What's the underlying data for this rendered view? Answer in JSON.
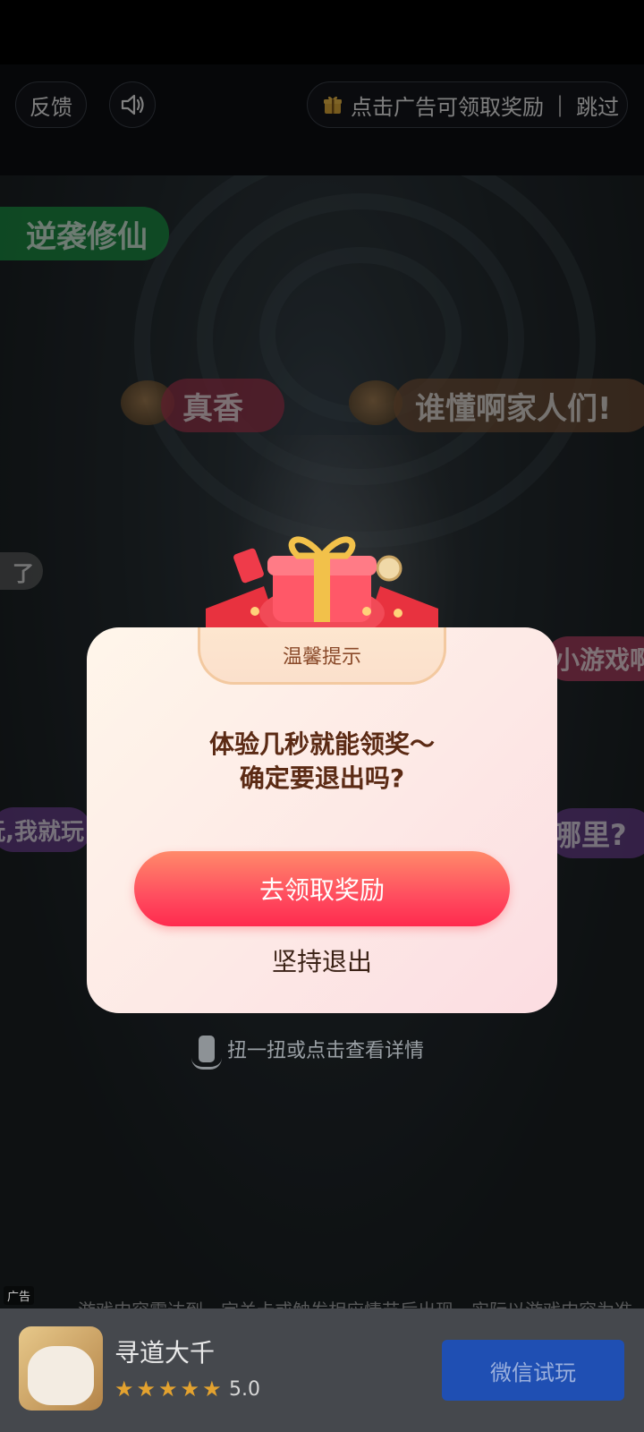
{
  "topbar": {
    "feedback_label": "反馈",
    "reward_label": "点击广告可领取奖励",
    "skip_label": "跳过"
  },
  "danmu": [
    "逆袭修仙",
    "真香",
    "谁懂啊家人们!",
    "了",
    "小游戏啊",
    "玩,我就玩",
    "哪里?"
  ],
  "dialog": {
    "title": "温馨提示",
    "message_line1": "体验几秒就能领奖～",
    "message_line2": "确定要退出吗?",
    "claim_button": "去领取奖励",
    "exit_button": "坚持退出"
  },
  "hint": "扭一扭或点击查看详情",
  "ad": {
    "tag": "广告",
    "disclaimer": "...游戏内容需达到一定关卡或触发相应情节后出现，实际以游戏内容为准",
    "app_name": "寻道大千",
    "rating": "5.0",
    "stars": 5,
    "cta": "微信试玩"
  },
  "colors": {
    "accent": "#ff4d5f",
    "cta_bg": "#1f4fb3",
    "star": "#e3a22f"
  }
}
